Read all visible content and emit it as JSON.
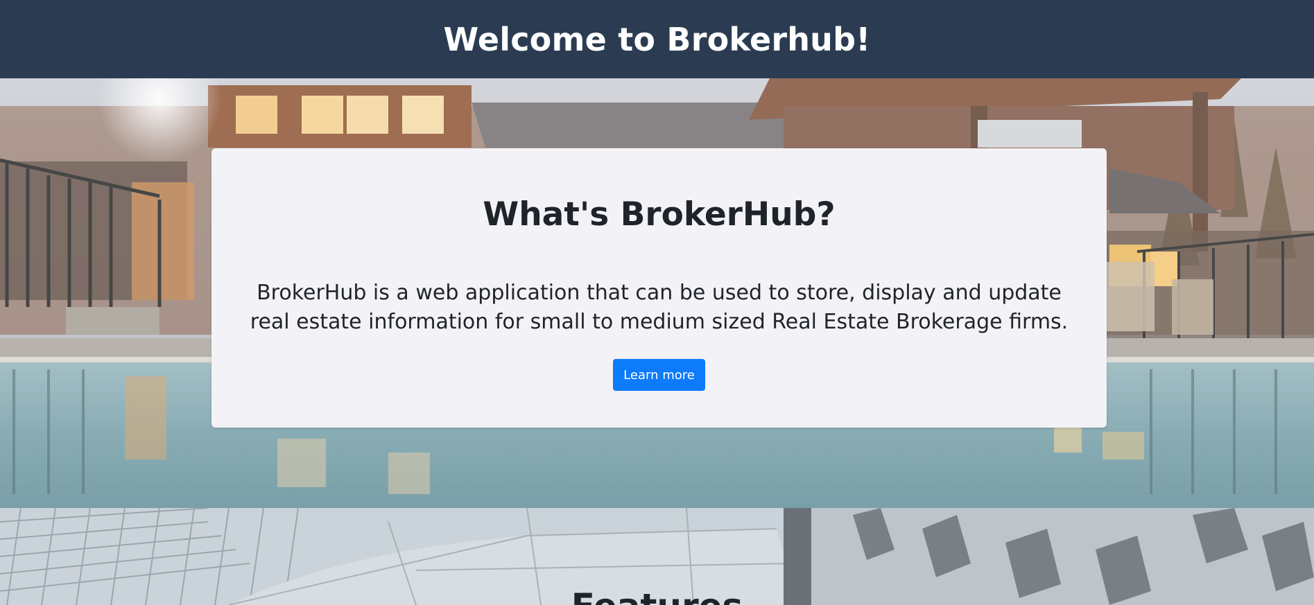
{
  "header": {
    "title": "Welcome to Brokerhub!"
  },
  "hero": {
    "image_alt": "house-with-pool-photo"
  },
  "info_card": {
    "heading": "What's BrokerHub?",
    "description": "BrokerHub is a web application that can be used to store, display and update real estate information for small to medium sized Real Estate Brokerage firms.",
    "button_label": "Learn more"
  },
  "features": {
    "title": "Features",
    "image_alt": "glass-building-photo"
  },
  "colors": {
    "header_bg": "#2b3c52",
    "card_bg": "#f3f2f7",
    "button_bg": "#0d7bfa",
    "text_dark": "#1f232a"
  }
}
